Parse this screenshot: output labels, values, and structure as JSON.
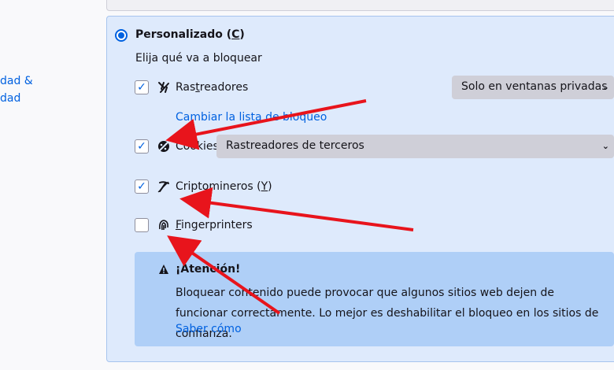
{
  "top_card": {},
  "sidebar": {
    "link_line1": "dad &",
    "link_line2": "dad"
  },
  "custom": {
    "radio_label_prefix": "Personalizado (",
    "radio_label_key": "C",
    "radio_label_suffix": ")",
    "subtitle": "Elija qué va a bloquear"
  },
  "options": {
    "trackers": {
      "label_prefix": "Ras",
      "label_key": "t",
      "label_suffix": "readores",
      "checked": true,
      "select_value": "Solo en ventanas privadas"
    },
    "change_list_link": "Cambiar la lista de bloqueo",
    "cookies": {
      "label": "Cookies",
      "checked": true,
      "select_value": "Rastreadores de terceros"
    },
    "cryptominers": {
      "label_prefix": "Criptomineros (",
      "label_key": "Y",
      "label_suffix": ")",
      "checked": true
    },
    "fingerprinters": {
      "label_key": "F",
      "label_suffix": "ingerprinters",
      "checked": false
    }
  },
  "warning": {
    "title": "¡Atención!",
    "text": "Bloquear contenido puede provocar que algunos sitios web dejen de funcionar correctamente. Lo mejor es deshabilitar el bloqueo en los sitios de confianza.",
    "learn_more": "Saber cómo"
  },
  "check_mark": "✓",
  "chevron": "⌄",
  "colors": {
    "accent": "#0061e0",
    "panel_bg": "#deeafc",
    "warning_bg": "#afcff7",
    "arrow": "#e8141c"
  },
  "icons": {
    "trackers": "tracker-icon",
    "cookies": "cookie-icon",
    "cryptominers": "cryptominer-icon",
    "fingerprinters": "fingerprint-icon",
    "warning": "warning-icon"
  }
}
